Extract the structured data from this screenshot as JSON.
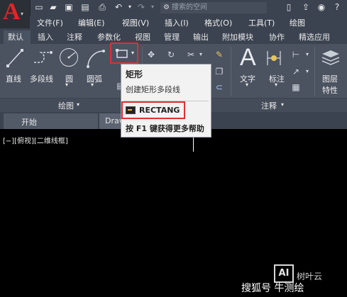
{
  "quick_access": {
    "search_placeholder": "搜索的空间",
    "icons": [
      "new-icon",
      "open-icon",
      "save-icon",
      "saveas-icon",
      "print-icon",
      "undo-icon",
      "redo-icon",
      "workspace-gear-icon"
    ]
  },
  "menubar": {
    "items": [
      "文件(F)",
      "编辑(E)",
      "视图(V)",
      "插入(I)",
      "格式(O)",
      "工具(T)",
      "绘图"
    ]
  },
  "ribbon_tabs": {
    "items": [
      "默认",
      "插入",
      "注释",
      "参数化",
      "视图",
      "管理",
      "输出",
      "附加模块",
      "协作",
      "精选应用"
    ],
    "active": "默认"
  },
  "ribbon": {
    "draw_tools": {
      "line": "直线",
      "polyline": "多段线",
      "circle": "圆",
      "arc": "圆弧"
    },
    "annotation_tools": {
      "text": "文字",
      "dimension": "标注"
    },
    "layer_tool": "图层\n特性",
    "layer_line1": "图层",
    "layer_line2": "特性",
    "panels": {
      "draw": "绘图",
      "annotation": "注释"
    }
  },
  "file_tabs": {
    "start": "开始",
    "drawing": "Draw"
  },
  "viewport_label": "[−][俯视][二维线框]",
  "tooltip": {
    "title": "矩形",
    "description": "创建矩形多段线",
    "command": "RECTANG",
    "help": "按 F1 键获得更多帮助"
  },
  "watermark": {
    "box": "AI",
    "brand": "树叶云",
    "source": "搜狐号 牛测绘"
  },
  "colors": {
    "accent_red": "#e03030",
    "ribbon_bg": "#4b5260",
    "bar_bg": "#3b4350",
    "canvas_bg": "#000000"
  }
}
